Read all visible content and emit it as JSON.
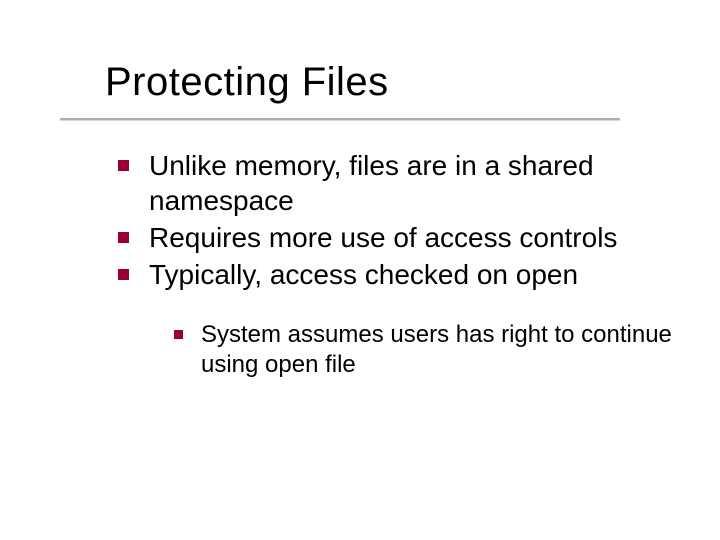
{
  "slide": {
    "title": "Protecting Files",
    "bullets": [
      "Unlike memory, files are in a shared namespace",
      "Requires more use of access controls",
      "Typically, access checked on open"
    ],
    "subbullets": [
      "System assumes users has right to continue using open file"
    ]
  }
}
